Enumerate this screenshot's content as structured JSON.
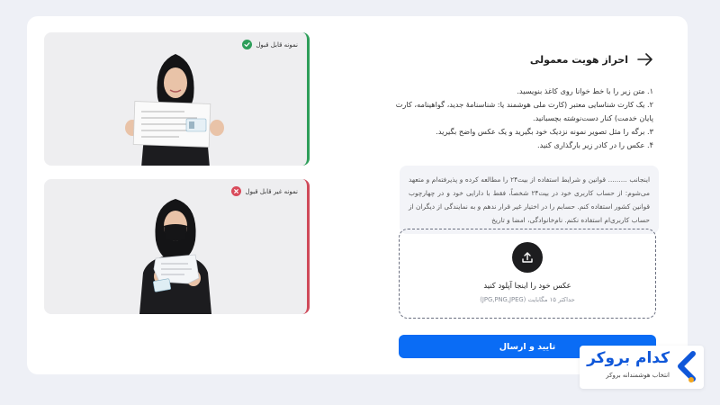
{
  "header": {
    "title": "احراز هویت معمولی",
    "back_icon": "arrow-right-icon"
  },
  "instructions": {
    "steps": [
      "۱. متن زیر را با خط خوانا روی کاغذ بنویسید.",
      "۲. یک کارت شناسایی معتبر (کارت ملی هوشمند یا: شناسنامهٔ جدید، گواهینامه، کارت پایان خدمت) کنار دست‌نوشته بچسبانید.",
      "۳. برگه را مثل تصویر نمونه نزدیک خود بگیرید و یک عکس واضح بگیرید.",
      "۴. عکس را در کادر زیر بارگذاری کنید."
    ]
  },
  "pledge": {
    "text": "اینجانب ......... قوانین و شرایط استفاده از بیت۲۴ را مطالعه کرده و پذیرفته‌ام و متعهد می‌شوم: از حساب کاربری خود در بیت۲۴ شخصاً، فقط با دارایی خود و در چهارچوب قوانین کشور استفاده کنم. حسابم را در اختیار غیر قرار ندهم و به نمایندگی از دیگران از حساب کاربری‌ام استفاده نکنم. نام‌خانوادگی، امضا و تاریخ"
  },
  "upload": {
    "icon": "upload-icon",
    "title": "عکس خود را اینجا آپلود کنید",
    "hint": "حداکثر ۱۵ مگابایت (JPG,PNG,JPEG)"
  },
  "submit": {
    "label": "تایید و ارسال"
  },
  "samples": {
    "acceptable": {
      "label": "نمونه قابل قبول",
      "status_icon": "check-icon",
      "color": "#2e9e5a"
    },
    "unacceptable": {
      "label": "نمونه غیر قابل قبول",
      "status_icon": "x-icon",
      "color": "#d94b5b"
    }
  },
  "brand": {
    "name": "کدام بروکر",
    "tagline": "انتخاب هوشمندانه بروکر",
    "accent": "#0f57d9"
  },
  "colors": {
    "primary_button": "#0a6cf5",
    "background": "#eef0f6"
  }
}
